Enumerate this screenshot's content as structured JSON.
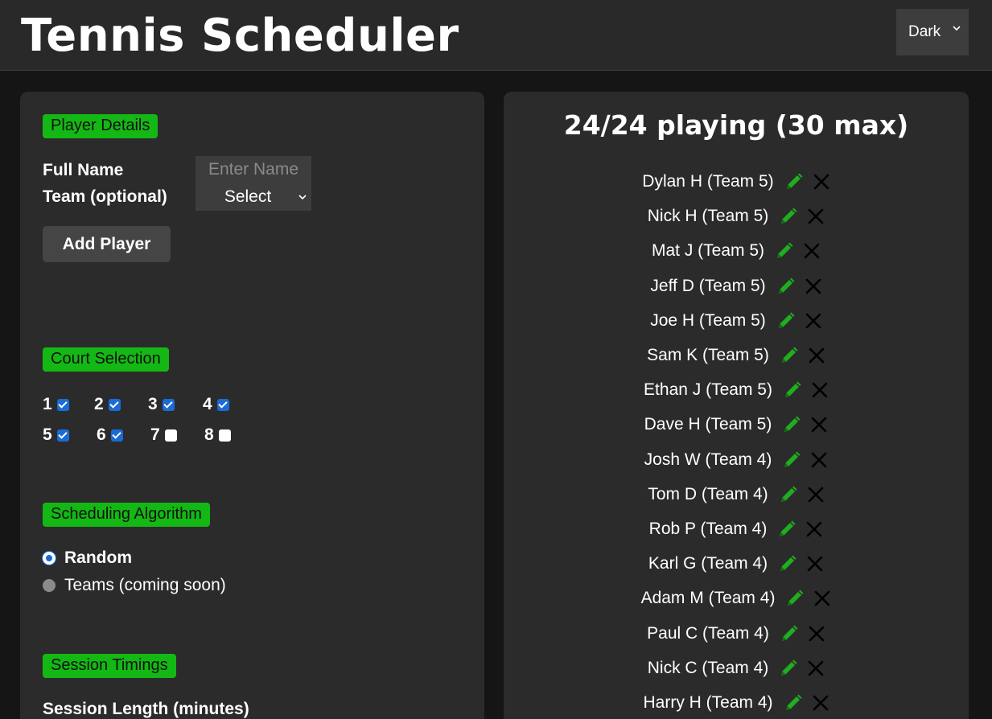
{
  "header": {
    "title": "Tennis Scheduler",
    "theme_value": "Dark"
  },
  "player_details": {
    "section_label": "Player Details",
    "full_name_label": "Full Name",
    "team_label": "Team (optional)",
    "name_placeholder": "Enter Name",
    "team_select_value": "Select",
    "add_button": "Add Player"
  },
  "court_selection": {
    "section_label": "Court Selection",
    "courts": [
      {
        "label": "1",
        "checked": true
      },
      {
        "label": "2",
        "checked": true
      },
      {
        "label": "3",
        "checked": true
      },
      {
        "label": "4",
        "checked": true
      },
      {
        "label": "5",
        "checked": true
      },
      {
        "label": "6",
        "checked": true
      },
      {
        "label": "7",
        "checked": false
      },
      {
        "label": "8",
        "checked": false
      }
    ]
  },
  "scheduling": {
    "section_label": "Scheduling Algorithm",
    "options": [
      {
        "label": "Random",
        "selected": true
      },
      {
        "label": "Teams (coming soon)",
        "selected": false
      }
    ]
  },
  "session": {
    "section_label": "Session Timings",
    "length_label": "Session Length (minutes)"
  },
  "players_panel": {
    "heading": "24/24 playing (30 max)",
    "players": [
      "Dylan H (Team 5)",
      "Nick H (Team 5)",
      "Mat J (Team 5)",
      "Jeff D (Team 5)",
      "Joe H (Team 5)",
      "Sam K (Team 5)",
      "Ethan J (Team 5)",
      "Dave H (Team 5)",
      "Josh W (Team 4)",
      "Tom D (Team 4)",
      "Rob P (Team 4)",
      "Karl G (Team 4)",
      "Adam M (Team 4)",
      "Paul C (Team 4)",
      "Nick C (Team 4)",
      "Harry H (Team 4)"
    ]
  },
  "colors": {
    "accent_green": "#14b814",
    "checkbox_blue": "#1a6bd6",
    "background": "#151515",
    "panel": "#2b2b2b"
  },
  "icons": {
    "edit": "pencil-icon",
    "delete": "close-icon",
    "dropdown": "chevron-down-icon"
  }
}
